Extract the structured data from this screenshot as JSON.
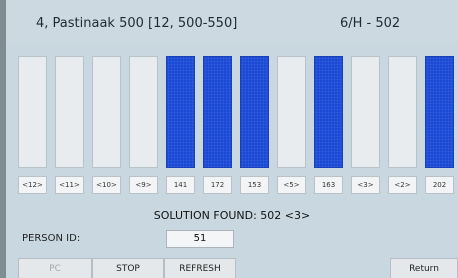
{
  "header": {
    "title": "4, Pastinaak  500 [12, 500-550]",
    "right": "6/H - 502"
  },
  "colors": {
    "selected_bar": "#1a49d6",
    "empty_bar": "#e9ecee",
    "screen_background": "#c9d8e0"
  },
  "bars": [
    {
      "label": "<12>",
      "selected": false
    },
    {
      "label": "<11>",
      "selected": false
    },
    {
      "label": "<10>",
      "selected": false
    },
    {
      "label": "<9>",
      "selected": false
    },
    {
      "label": "141",
      "selected": true
    },
    {
      "label": "172",
      "selected": true
    },
    {
      "label": "153",
      "selected": true
    },
    {
      "label": "<5>",
      "selected": false
    },
    {
      "label": "163",
      "selected": true
    },
    {
      "label": "<3>",
      "selected": false
    },
    {
      "label": "<2>",
      "selected": false
    },
    {
      "label": "202",
      "selected": true
    }
  ],
  "solution": "SOLUTION FOUND: 502 <3>",
  "person": {
    "label": "PERSON ID:",
    "value": "51"
  },
  "buttons": {
    "pc": "PC",
    "stop": "STOP",
    "refresh": "REFRESH",
    "return": "Return"
  }
}
